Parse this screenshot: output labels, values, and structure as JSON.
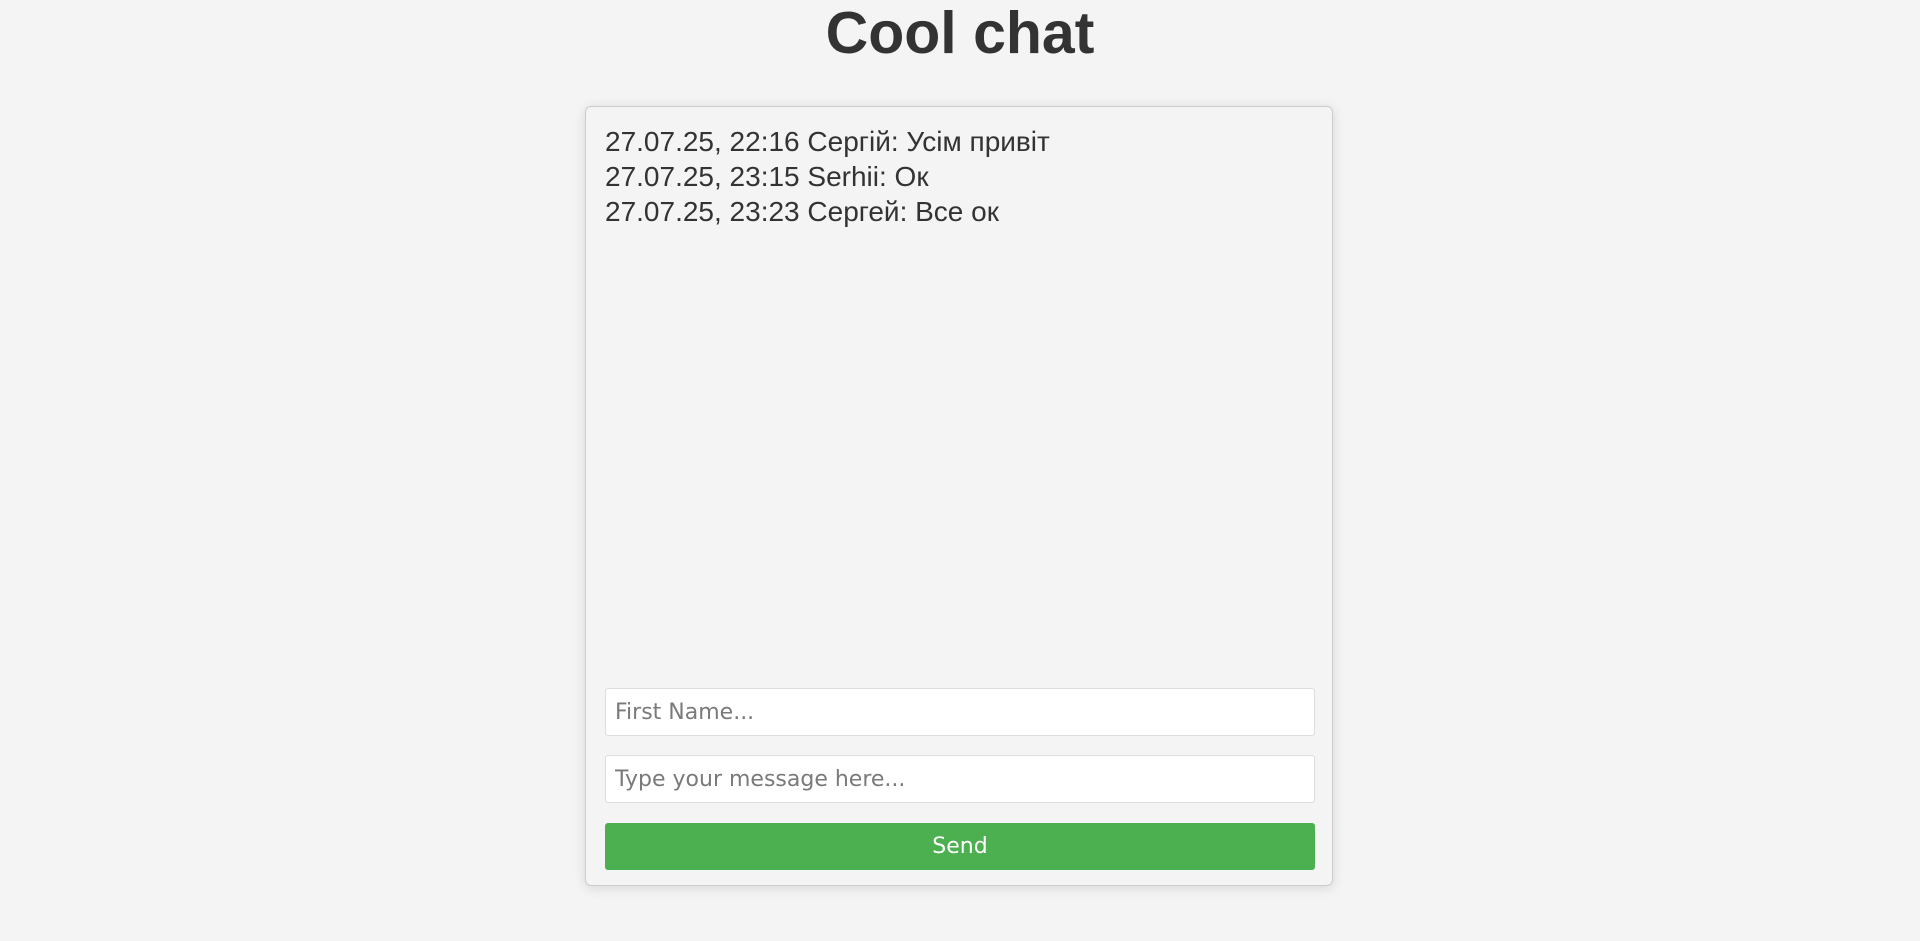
{
  "header": {
    "title": "Cool chat"
  },
  "chat": {
    "messages": [
      {
        "text": "27.07.25, 22:16 Сергій: Усім привіт"
      },
      {
        "text": "27.07.25, 23:15 Serhii: Ок"
      },
      {
        "text": "27.07.25, 23:23 Сергей: Все ок"
      }
    ]
  },
  "form": {
    "name_placeholder": "First Name...",
    "name_value": "",
    "message_placeholder": "Type your message here...",
    "message_value": "",
    "send_label": "Send"
  },
  "colors": {
    "background": "#f4f4f4",
    "text": "#333333",
    "send_button": "#4caf50",
    "send_button_text": "#ffffff"
  }
}
